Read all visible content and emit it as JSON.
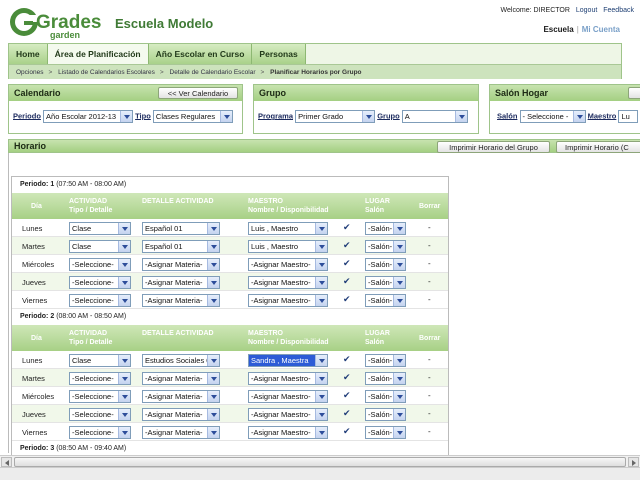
{
  "header": {
    "logo_text_top": "Grades",
    "logo_text_bottom": "garden",
    "school_name": "Escuela Modelo",
    "welcome": "Welcome: DIRECTOR",
    "logout": "Logout",
    "feedback": "Feedback",
    "link_escuela": "Escuela",
    "link_cuenta": "Mi Cuenta"
  },
  "nav": {
    "tabs": [
      "Home",
      "Área de Planificación",
      "Año Escolar en Curso",
      "Personas"
    ],
    "breadcrumbs": [
      "Opciones",
      "Listado de Calendarios Escolares",
      "Detalle de Calendario Escolar",
      "Planificar Horarios por Grupo"
    ]
  },
  "calendario": {
    "title": "Calendario",
    "button": "<< Ver Calendario",
    "periodo_label": "Periodo",
    "periodo_value": "Año Escolar 2012-13",
    "tipo_label": "Tipo",
    "tipo_value": "Clases Regulares"
  },
  "grupo": {
    "title": "Grupo",
    "programa_label": "Programa",
    "programa_value": "Primer Grado",
    "grupo_label": "Grupo",
    "grupo_value": "A"
  },
  "salon": {
    "title": "Salón Hogar",
    "salon_label": "Salón",
    "salon_value": "- Seleccione -",
    "maestro_label": "Maestro",
    "maestro_value": "Lu"
  },
  "horario": {
    "title": "Horario",
    "btn_grupo": "Imprimir Horario del Grupo",
    "btn_other": "Imprimir Horario (C"
  },
  "table": {
    "col_dia": "Día",
    "col_actividad_1": "ACTIVIDAD",
    "col_actividad_2": "Tipo / Detalle",
    "col_detalle": "DETALLE ACTIVIDAD",
    "col_maestro_1": "MAESTRO",
    "col_maestro_2": "Nombre / Disponibilidad",
    "col_lugar_1": "LUGAR",
    "col_lugar_2": "Salón",
    "col_borrar": "Borrar",
    "check": "✔",
    "dash": "-"
  },
  "periods": [
    {
      "label": "Periodo: 1",
      "time": "(07:50 AM - 08:00 AM)",
      "rows": [
        {
          "day": "Lunes",
          "tipo": "Clase",
          "detalle": "Español 01",
          "maestro": "Luis , Maestro",
          "salon": "-Salón-"
        },
        {
          "day": "Martes",
          "tipo": "Clase",
          "detalle": "Español 01",
          "maestro": "Luis , Maestro",
          "salon": "-Salón-"
        },
        {
          "day": "Miércoles",
          "tipo": "-Seleccione-",
          "detalle": "-Asignar Materia-",
          "maestro": "-Asignar Maestro-",
          "salon": "-Salón-"
        },
        {
          "day": "Jueves",
          "tipo": "-Seleccione-",
          "detalle": "-Asignar Materia-",
          "maestro": "-Asignar Maestro-",
          "salon": "-Salón-"
        },
        {
          "day": "Viernes",
          "tipo": "-Seleccione-",
          "detalle": "-Asignar Materia-",
          "maestro": "-Asignar Maestro-",
          "salon": "-Salón-"
        }
      ]
    },
    {
      "label": "Periodo: 2",
      "time": "(08:00 AM - 08:50 AM)",
      "rows": [
        {
          "day": "Lunes",
          "tipo": "Clase",
          "detalle": "Estudios Sociales 01",
          "maestro": "Sandra , Maestra",
          "salon": "-Salón-"
        },
        {
          "day": "Martes",
          "tipo": "-Seleccione-",
          "detalle": "-Asignar Materia-",
          "maestro": "-Asignar Maestro-",
          "salon": "-Salón-"
        },
        {
          "day": "Miércoles",
          "tipo": "-Seleccione-",
          "detalle": "-Asignar Materia-",
          "maestro": "-Asignar Maestro-",
          "salon": "-Salón-"
        },
        {
          "day": "Jueves",
          "tipo": "-Seleccione-",
          "detalle": "-Asignar Materia-",
          "maestro": "-Asignar Maestro-",
          "salon": "-Salón-"
        },
        {
          "day": "Viernes",
          "tipo": "-Seleccione-",
          "detalle": "-Asignar Materia-",
          "maestro": "-Asignar Maestro-",
          "salon": "-Salón-"
        }
      ]
    },
    {
      "label": "Periodo: 3",
      "time": "(08:50 AM - 09:40 AM)",
      "rows": []
    }
  ]
}
